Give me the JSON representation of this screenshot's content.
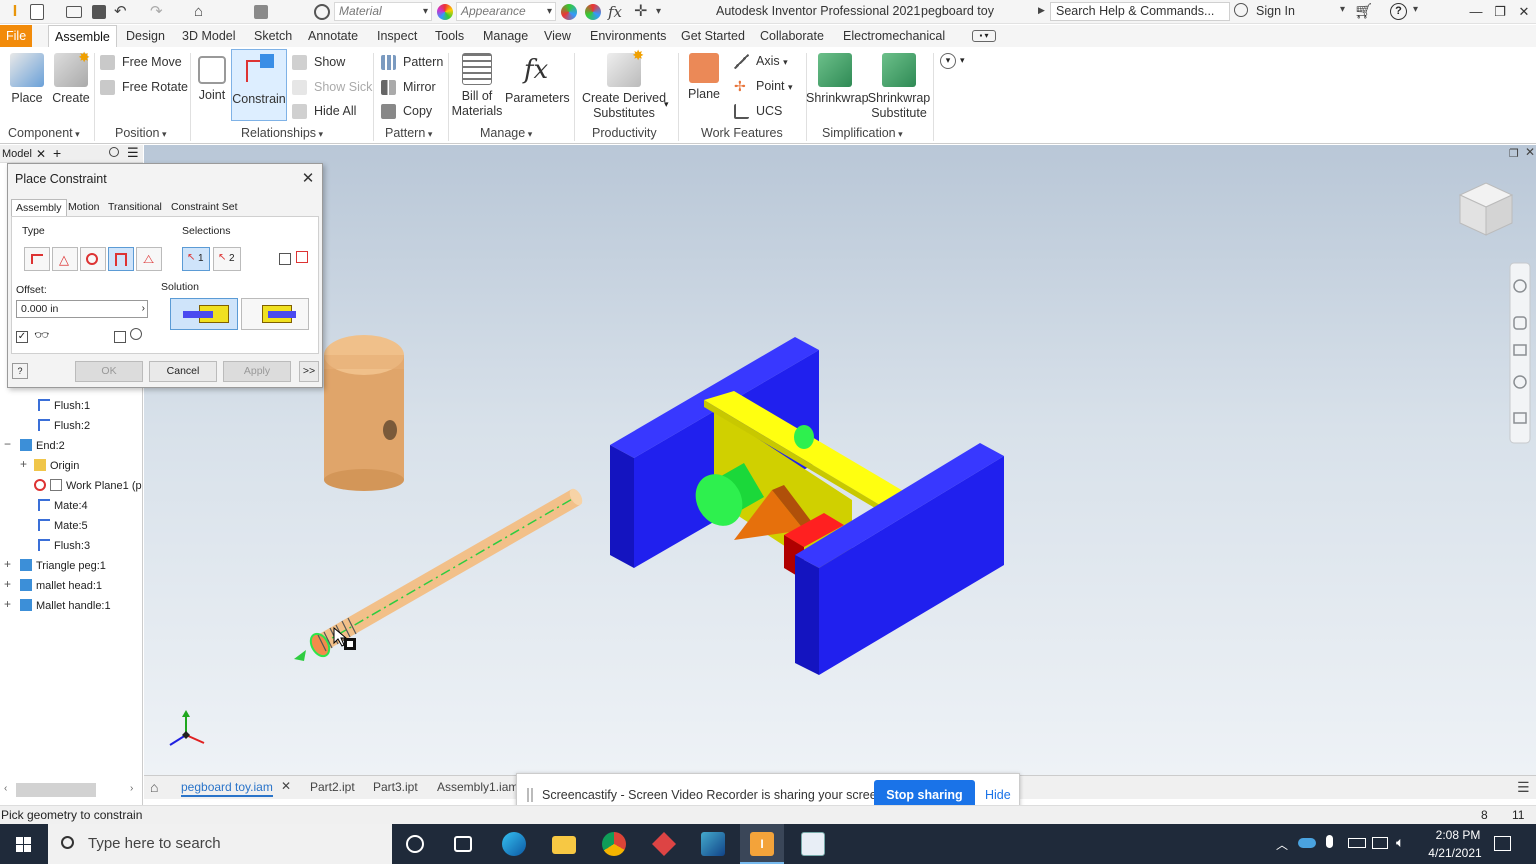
{
  "titlebar": {
    "material_placeholder": "Material",
    "appearance_placeholder": "Appearance",
    "app_title": "Autodesk Inventor Professional 2021",
    "doc_title": "pegboard toy",
    "search_placeholder": "Search Help & Commands...",
    "sign_in": "Sign In"
  },
  "tabs": [
    "File",
    "Assemble",
    "Design",
    "3D Model",
    "Sketch",
    "Annotate",
    "Inspect",
    "Tools",
    "Manage",
    "View",
    "Environments",
    "Get Started",
    "Collaborate",
    "Electromechanical"
  ],
  "ribbon": {
    "place": "Place",
    "create": "Create",
    "free_move": "Free Move",
    "free_rotate": "Free Rotate",
    "joint": "Joint",
    "constrain": "Constrain",
    "show": "Show",
    "show_sick": "Show Sick",
    "hide_all": "Hide All",
    "pattern": "Pattern",
    "mirror": "Mirror",
    "copy": "Copy",
    "bom_1": "Bill of",
    "bom_2": "Materials",
    "parameters": "Parameters",
    "derived_1": "Create Derived",
    "derived_2": "Substitutes",
    "plane": "Plane",
    "axis": "Axis",
    "point": "Point",
    "ucs": "UCS",
    "shrinkwrap": "Shrinkwrap",
    "shrinkwrap_sub_1": "Shrinkwrap",
    "shrinkwrap_sub_2": "Substitute",
    "groups": {
      "component": "Component",
      "position": "Position",
      "relationships": "Relationships",
      "pattern": "Pattern",
      "manage": "Manage",
      "productivity": "Productivity",
      "work_features": "Work Features",
      "simplification": "Simplification"
    }
  },
  "browser": {
    "tab": "Model",
    "items": [
      {
        "label": "Flush:1"
      },
      {
        "label": "Flush:2"
      },
      {
        "label": "End:2"
      },
      {
        "label": "Origin"
      },
      {
        "label": "Work Plane1 (p"
      },
      {
        "label": "Mate:4"
      },
      {
        "label": "Mate:5"
      },
      {
        "label": "Flush:3"
      },
      {
        "label": "Triangle peg:1"
      },
      {
        "label": "mallet head:1"
      },
      {
        "label": "Mallet handle:1"
      }
    ]
  },
  "dialog": {
    "title": "Place Constraint",
    "tabs": [
      "Assembly",
      "Motion",
      "Transitional",
      "Constraint Set"
    ],
    "type_label": "Type",
    "selections_label": "Selections",
    "sel1": "1",
    "sel2": "2",
    "offset_label": "Offset:",
    "offset_value": "0.000 in",
    "solution_label": "Solution",
    "ok": "OK",
    "cancel": "Cancel",
    "apply": "Apply",
    "more": ">>"
  },
  "doc_tabs": [
    "pegboard toy.iam",
    "Part2.ipt",
    "Part3.ipt",
    "Assembly1.iam"
  ],
  "share": {
    "text": "Screencastify - Screen Video Recorder is sharing your screen.",
    "stop": "Stop sharing",
    "hide": "Hide"
  },
  "status": {
    "text": "Pick geometry to constrain",
    "count1": "8",
    "count2": "11"
  },
  "taskbar": {
    "search_placeholder": "Type here to search",
    "time": "2:08 PM",
    "date": "4/21/2021"
  },
  "colors": {
    "file_tab": "#f28b0a",
    "accent_blue": "#1a73e8",
    "block_blue": "#1e1ef0",
    "yellow": "#f5f500",
    "green": "#1ed83c",
    "orange": "#ee7a10",
    "red": "#e01010"
  }
}
